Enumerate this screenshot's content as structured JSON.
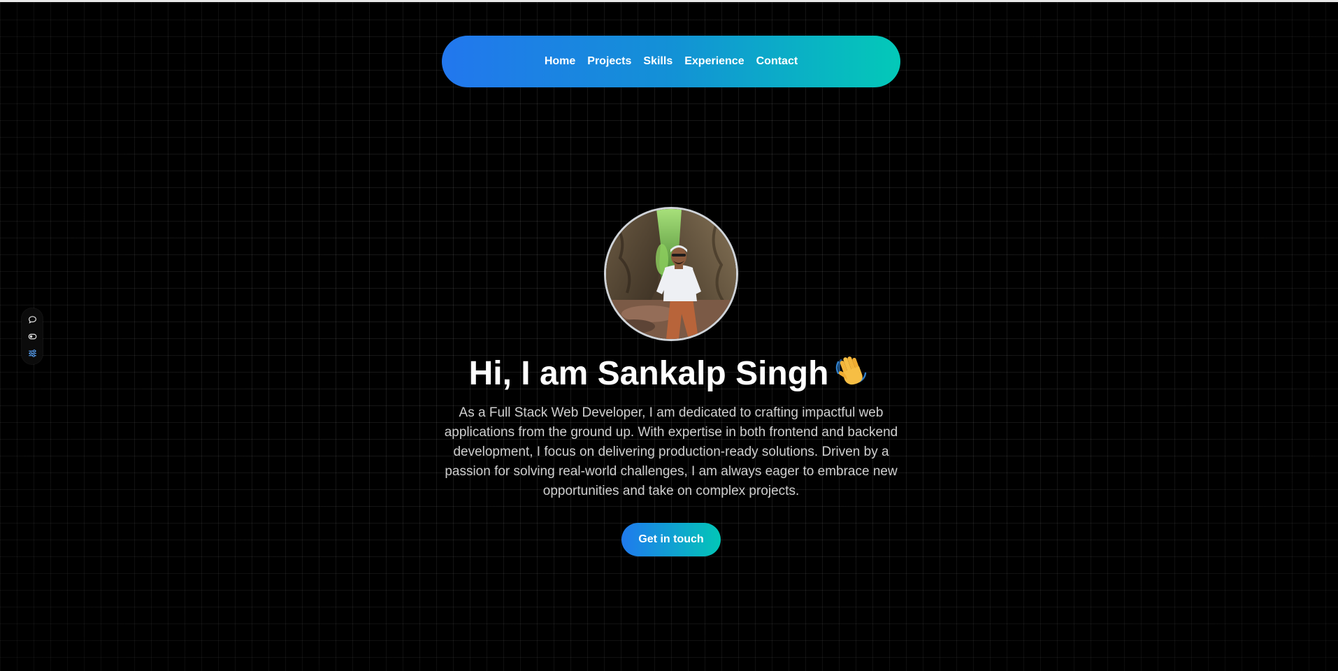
{
  "nav": {
    "items": [
      {
        "label": "Home"
      },
      {
        "label": "Projects"
      },
      {
        "label": "Skills"
      },
      {
        "label": "Experience"
      },
      {
        "label": "Contact"
      }
    ]
  },
  "side_toolbar": {
    "icons": [
      "chat-icon",
      "toggle-icon",
      "sliders-icon"
    ]
  },
  "hero": {
    "avatar_icon": "profile-photo",
    "headline": "Hi, I am Sankalp Singh",
    "headline_emoji_icon": "waving-hand-icon",
    "bio": "As a Full Stack Web Developer, I am dedicated to crafting impactful web applications from the ground up. With expertise in both frontend and backend development, I focus on delivering production-ready solutions. Driven by a passion for solving real-world challenges, I am always eager to embrace new opportunities and take on complex projects.",
    "cta_label": "Get in touch"
  },
  "colors": {
    "background": "#000000",
    "gradient_start": "#2277ee",
    "gradient_end": "#03c9b8",
    "text_primary": "#ffffff",
    "text_secondary": "#cfcfcf"
  }
}
